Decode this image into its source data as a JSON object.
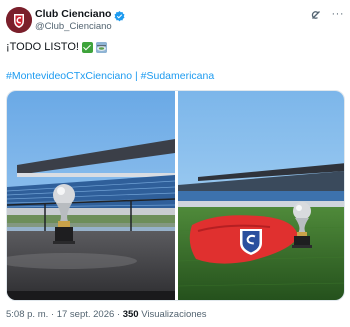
{
  "account": {
    "display_name": "Club Cienciano",
    "handle": "@Club_Cienciano",
    "verified_icon": "verified-badge-icon",
    "avatar_icon": "cienciano-crest-avatar"
  },
  "actions": {
    "grok_icon": "grok-icon",
    "more_label": "···"
  },
  "tweet": {
    "text": "¡TODO LISTO!",
    "emojis": [
      "check-mark-emoji",
      "stadium-emoji"
    ],
    "hashtag_1": "#MontevideoCTxCienciano",
    "separator": "|",
    "hashtag_2": "#Sudamericana"
  },
  "media": {
    "photo_1": "stadium-trophy-photo",
    "photo_2": "pitch-trophy-jersey-photo"
  },
  "meta": {
    "time": "5:08 p. m.",
    "dot": "·",
    "date": "17 sept. 2026",
    "dot2": "·",
    "views_count": "350",
    "views_label": "Visualizaciones"
  },
  "colors": {
    "link": "#1d9bf0",
    "verified": "#1d9bf0",
    "club": "#7a1f2b"
  }
}
